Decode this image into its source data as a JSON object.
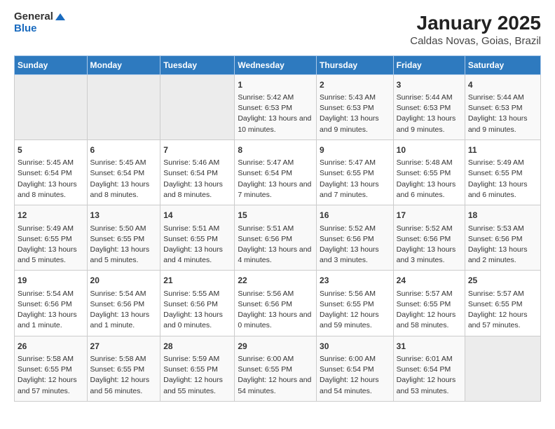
{
  "header": {
    "logo_general": "General",
    "logo_blue": "Blue",
    "title": "January 2025",
    "subtitle": "Caldas Novas, Goias, Brazil"
  },
  "weekdays": [
    "Sunday",
    "Monday",
    "Tuesday",
    "Wednesday",
    "Thursday",
    "Friday",
    "Saturday"
  ],
  "weeks": [
    [
      {
        "day": "",
        "info": ""
      },
      {
        "day": "",
        "info": ""
      },
      {
        "day": "",
        "info": ""
      },
      {
        "day": "1",
        "info": "Sunrise: 5:42 AM\nSunset: 6:53 PM\nDaylight: 13 hours and 10 minutes."
      },
      {
        "day": "2",
        "info": "Sunrise: 5:43 AM\nSunset: 6:53 PM\nDaylight: 13 hours and 9 minutes."
      },
      {
        "day": "3",
        "info": "Sunrise: 5:44 AM\nSunset: 6:53 PM\nDaylight: 13 hours and 9 minutes."
      },
      {
        "day": "4",
        "info": "Sunrise: 5:44 AM\nSunset: 6:53 PM\nDaylight: 13 hours and 9 minutes."
      }
    ],
    [
      {
        "day": "5",
        "info": "Sunrise: 5:45 AM\nSunset: 6:54 PM\nDaylight: 13 hours and 8 minutes."
      },
      {
        "day": "6",
        "info": "Sunrise: 5:45 AM\nSunset: 6:54 PM\nDaylight: 13 hours and 8 minutes."
      },
      {
        "day": "7",
        "info": "Sunrise: 5:46 AM\nSunset: 6:54 PM\nDaylight: 13 hours and 8 minutes."
      },
      {
        "day": "8",
        "info": "Sunrise: 5:47 AM\nSunset: 6:54 PM\nDaylight: 13 hours and 7 minutes."
      },
      {
        "day": "9",
        "info": "Sunrise: 5:47 AM\nSunset: 6:55 PM\nDaylight: 13 hours and 7 minutes."
      },
      {
        "day": "10",
        "info": "Sunrise: 5:48 AM\nSunset: 6:55 PM\nDaylight: 13 hours and 6 minutes."
      },
      {
        "day": "11",
        "info": "Sunrise: 5:49 AM\nSunset: 6:55 PM\nDaylight: 13 hours and 6 minutes."
      }
    ],
    [
      {
        "day": "12",
        "info": "Sunrise: 5:49 AM\nSunset: 6:55 PM\nDaylight: 13 hours and 5 minutes."
      },
      {
        "day": "13",
        "info": "Sunrise: 5:50 AM\nSunset: 6:55 PM\nDaylight: 13 hours and 5 minutes."
      },
      {
        "day": "14",
        "info": "Sunrise: 5:51 AM\nSunset: 6:55 PM\nDaylight: 13 hours and 4 minutes."
      },
      {
        "day": "15",
        "info": "Sunrise: 5:51 AM\nSunset: 6:56 PM\nDaylight: 13 hours and 4 minutes."
      },
      {
        "day": "16",
        "info": "Sunrise: 5:52 AM\nSunset: 6:56 PM\nDaylight: 13 hours and 3 minutes."
      },
      {
        "day": "17",
        "info": "Sunrise: 5:52 AM\nSunset: 6:56 PM\nDaylight: 13 hours and 3 minutes."
      },
      {
        "day": "18",
        "info": "Sunrise: 5:53 AM\nSunset: 6:56 PM\nDaylight: 13 hours and 2 minutes."
      }
    ],
    [
      {
        "day": "19",
        "info": "Sunrise: 5:54 AM\nSunset: 6:56 PM\nDaylight: 13 hours and 1 minute."
      },
      {
        "day": "20",
        "info": "Sunrise: 5:54 AM\nSunset: 6:56 PM\nDaylight: 13 hours and 1 minute."
      },
      {
        "day": "21",
        "info": "Sunrise: 5:55 AM\nSunset: 6:56 PM\nDaylight: 13 hours and 0 minutes."
      },
      {
        "day": "22",
        "info": "Sunrise: 5:56 AM\nSunset: 6:56 PM\nDaylight: 13 hours and 0 minutes."
      },
      {
        "day": "23",
        "info": "Sunrise: 5:56 AM\nSunset: 6:55 PM\nDaylight: 12 hours and 59 minutes."
      },
      {
        "day": "24",
        "info": "Sunrise: 5:57 AM\nSunset: 6:55 PM\nDaylight: 12 hours and 58 minutes."
      },
      {
        "day": "25",
        "info": "Sunrise: 5:57 AM\nSunset: 6:55 PM\nDaylight: 12 hours and 57 minutes."
      }
    ],
    [
      {
        "day": "26",
        "info": "Sunrise: 5:58 AM\nSunset: 6:55 PM\nDaylight: 12 hours and 57 minutes."
      },
      {
        "day": "27",
        "info": "Sunrise: 5:58 AM\nSunset: 6:55 PM\nDaylight: 12 hours and 56 minutes."
      },
      {
        "day": "28",
        "info": "Sunrise: 5:59 AM\nSunset: 6:55 PM\nDaylight: 12 hours and 55 minutes."
      },
      {
        "day": "29",
        "info": "Sunrise: 6:00 AM\nSunset: 6:55 PM\nDaylight: 12 hours and 54 minutes."
      },
      {
        "day": "30",
        "info": "Sunrise: 6:00 AM\nSunset: 6:54 PM\nDaylight: 12 hours and 54 minutes."
      },
      {
        "day": "31",
        "info": "Sunrise: 6:01 AM\nSunset: 6:54 PM\nDaylight: 12 hours and 53 minutes."
      },
      {
        "day": "",
        "info": ""
      }
    ]
  ]
}
